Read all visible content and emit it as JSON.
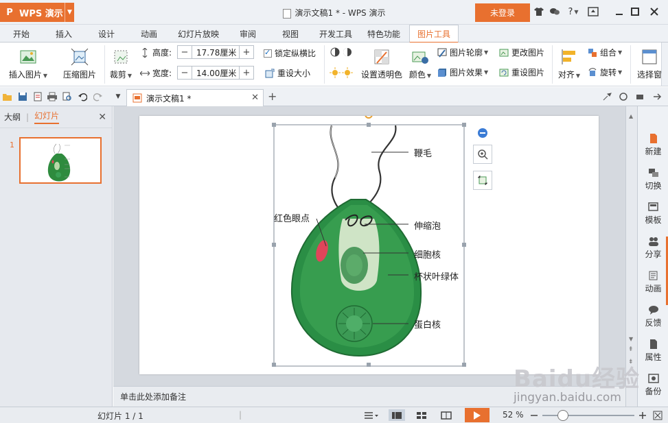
{
  "app": {
    "logo": "P",
    "name": "WPS 演示"
  },
  "window": {
    "title": "演示文稿1 * - WPS 演示",
    "login_label": "未登录"
  },
  "tabs": [
    "开始",
    "插入",
    "设计",
    "动画",
    "幻灯片放映",
    "审阅",
    "视图",
    "开发工具",
    "特色功能",
    "图片工具"
  ],
  "ribbon": {
    "insert_picture": "插入图片",
    "compress_picture": "压缩图片",
    "crop": "裁剪",
    "height_label": "高度:",
    "height_value": "17.78厘米",
    "width_label": "宽度:",
    "width_value": "14.00厘米",
    "lock_ratio": "锁定纵横比",
    "reset_size": "重设大小",
    "set_transparent": "设置透明色",
    "color": "颜色",
    "picture_outline": "图片轮廓",
    "picture_effect": "图片效果",
    "change_picture": "更改图片",
    "reset_picture": "重设图片",
    "align": "对齐",
    "group": "组合",
    "rotate": "旋转",
    "selection_pane": "选择窗"
  },
  "doc_tab": {
    "title": "演示文稿1 *"
  },
  "left_panel": {
    "tab_outline": "大纲",
    "tab_slides": "幻灯片",
    "slide_number": "1"
  },
  "slide": {
    "labels": {
      "flagellum": "鞭毛",
      "eyespot": "红色眼点",
      "contractile_vacuole": "伸缩泡",
      "nucleus": "细胞核",
      "chloroplast": "杯状叶绿体",
      "pyrenoid": "蛋白核"
    }
  },
  "notes_placeholder": "单击此处添加备注",
  "right_panel": [
    "新建",
    "切换",
    "模板",
    "分享",
    "动画",
    "反馈",
    "属性",
    "备份"
  ],
  "status": {
    "slide_info": "幻灯片 1 / 1",
    "zoom": "52 %"
  },
  "watermark": {
    "logo": "Baidu经验",
    "url": "jingyan.baidu.com"
  },
  "colors": {
    "accent": "#e8702f",
    "cell_green": "#2e8b3e",
    "eyespot_red": "#e0455a"
  }
}
